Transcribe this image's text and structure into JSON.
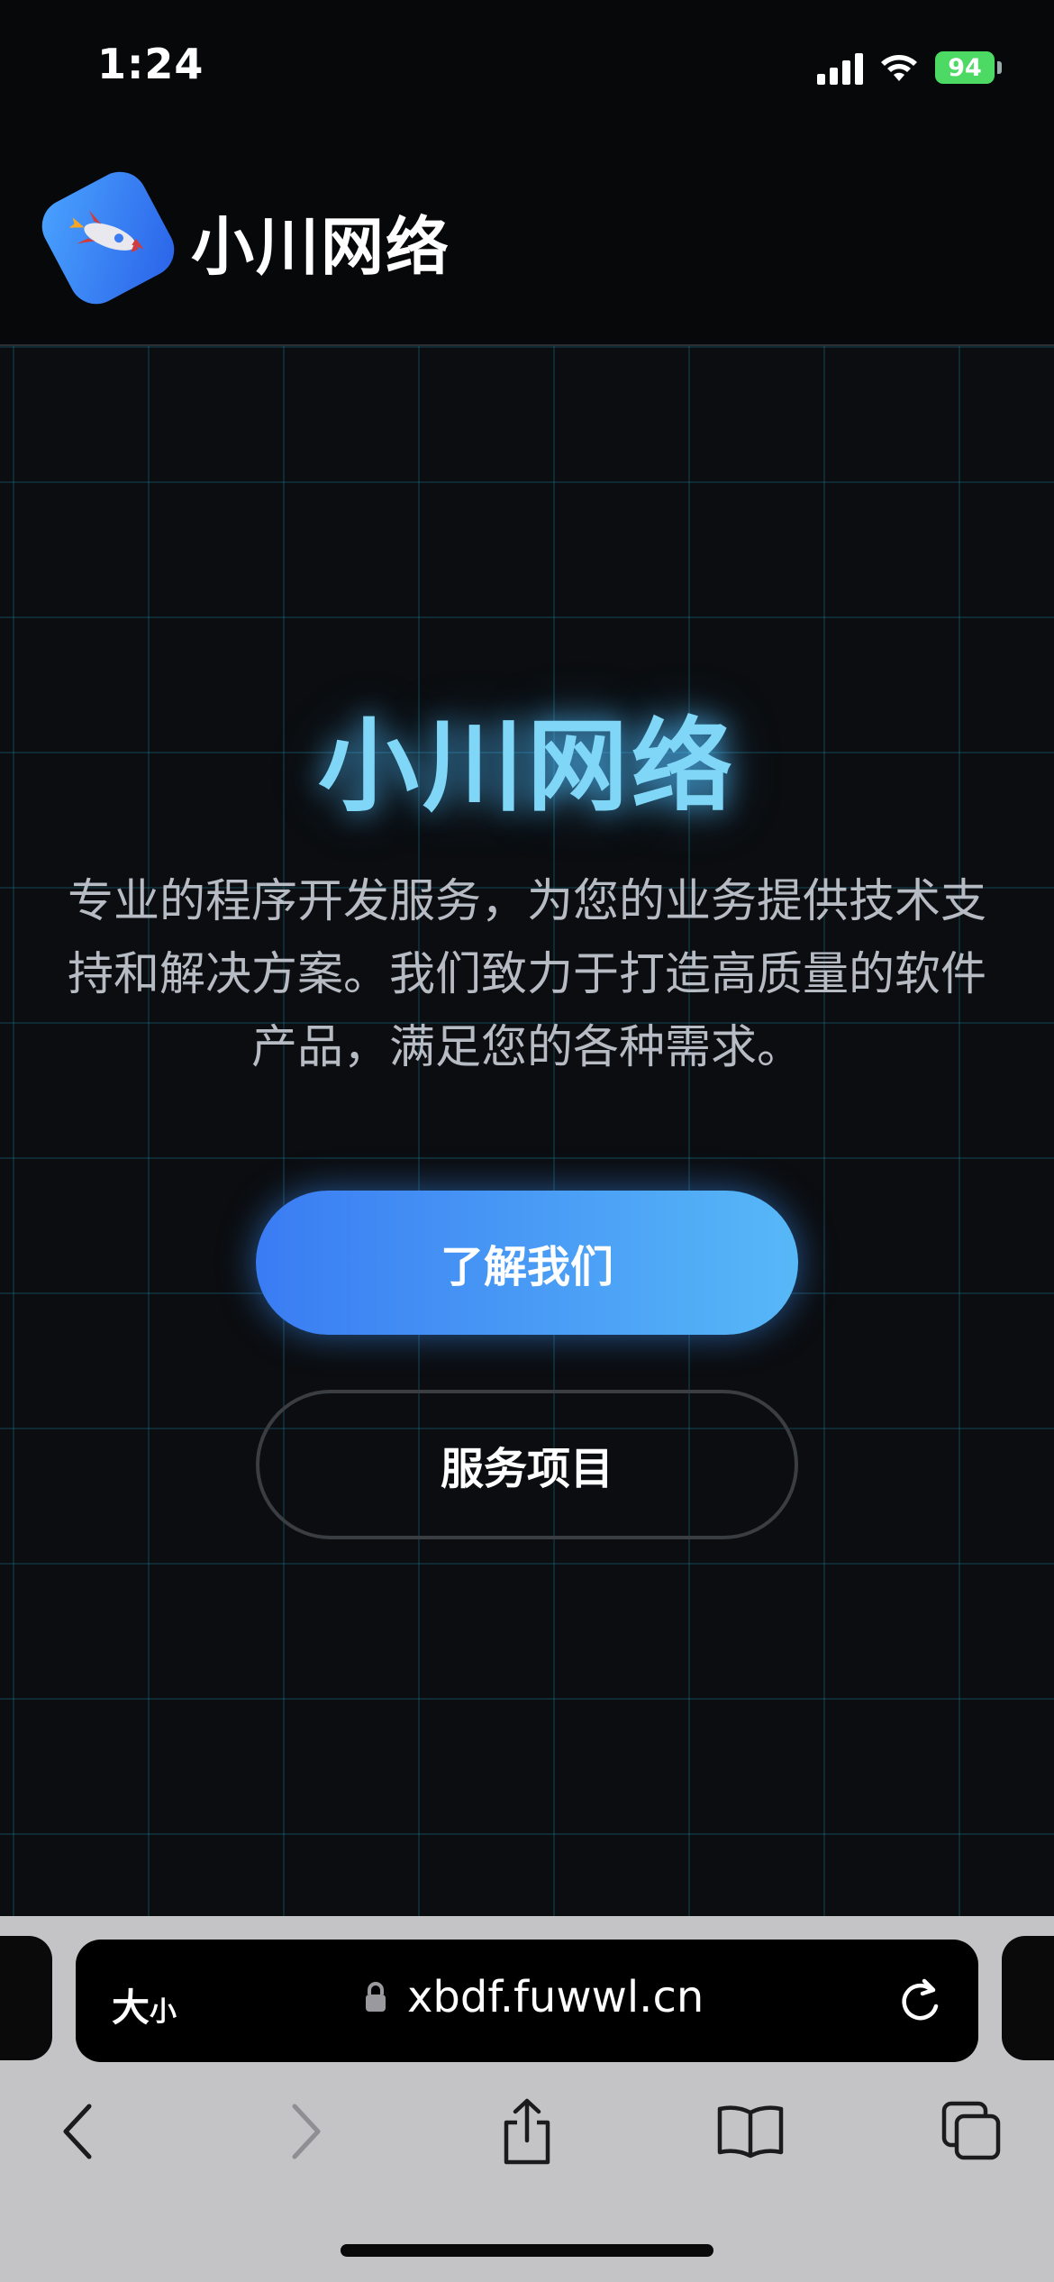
{
  "status": {
    "time": "1:24",
    "battery": "94"
  },
  "header": {
    "brand_name": "小川网络"
  },
  "hero": {
    "title": "小川网络",
    "description": "专业的程序开发服务，为您的业务提供技术支持和解决方案。我们致力于打造高质量的软件产品，满足您的各种需求。",
    "primary_button": "了解我们",
    "secondary_button": "服务项目"
  },
  "browser": {
    "text_size_label": "大",
    "text_size_small": "小",
    "url": "xbdf.fuwwl.cn"
  },
  "icons": [
    "rocket-icon",
    "lock-icon",
    "reload-icon",
    "back-icon",
    "forward-icon",
    "share-icon",
    "bookmarks-icon",
    "tabs-icon",
    "signal-icon",
    "wifi-icon",
    "battery-icon"
  ]
}
